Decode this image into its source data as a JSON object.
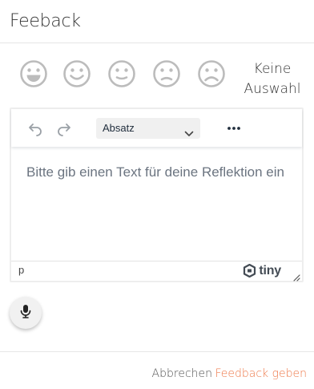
{
  "dialog": {
    "title": "Feeback"
  },
  "feedback": {
    "options": [
      {
        "icon": "very-happy-face-icon"
      },
      {
        "icon": "happy-face-icon"
      },
      {
        "icon": "neutral-face-icon"
      },
      {
        "icon": "sad-face-icon"
      },
      {
        "icon": "very-sad-face-icon"
      }
    ],
    "none_label_line1": "Keine",
    "none_label_line2": "Auswahl"
  },
  "editor": {
    "toolbar": {
      "undo_icon": "undo-icon",
      "redo_icon": "redo-icon",
      "block_format": "Absatz",
      "more_icon": "more-icon"
    },
    "placeholder": "Bitte gib einen Text für deine Reflektion ein",
    "statusbar": {
      "path": "p",
      "brand": "tiny"
    }
  },
  "voice": {
    "icon": "microphone-icon"
  },
  "actions": {
    "cancel": "Abbrechen",
    "submit": "Feedback geben"
  },
  "colors": {
    "icon_gray": "#bcbcbc",
    "accent": "#ee7a4b",
    "text": "#333333"
  }
}
